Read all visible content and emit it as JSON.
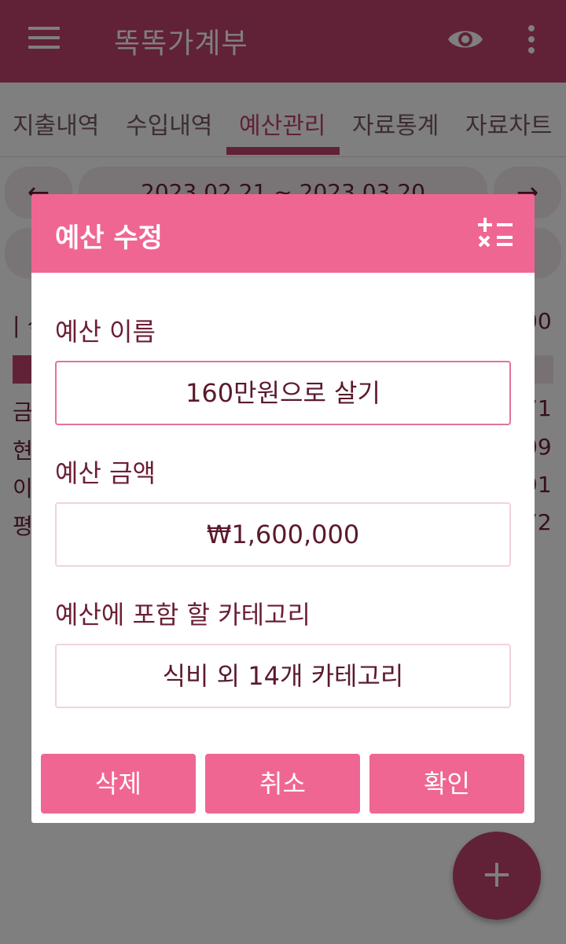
{
  "app": {
    "title": "똑똑가계부"
  },
  "tabs": [
    "지출내역",
    "수입내역",
    "예산관리",
    "자료통계",
    "자료차트"
  ],
  "date_range": {
    "prev": "←",
    "range": "2023.02.21 ~ 2023.03.20",
    "next": "→"
  },
  "background_rows": {
    "first_char": [
      "| 식",
      "금",
      "현",
      "이",
      "평"
    ],
    "last_digits": [
      "00",
      "71",
      "09",
      "91",
      "72"
    ]
  },
  "fab_label": "+",
  "dialog": {
    "title": "예산 수정",
    "budget_name": {
      "label": "예산 이름",
      "value": "160만원으로 살기"
    },
    "budget_amount": {
      "label": "예산 금액",
      "value": "₩1,600,000"
    },
    "categories": {
      "label": "예산에 포함 할 카테고리",
      "value": "식비 외 14개 카테고리"
    },
    "buttons": {
      "delete": "삭제",
      "cancel": "취소",
      "confirm": "확인"
    }
  },
  "colors": {
    "appbar": "#c2426d",
    "dialog_header": "#f06693",
    "button": "#f06693",
    "text_primary": "#6b1f35"
  },
  "icons": [
    "menu-icon",
    "eye-icon",
    "more-vert-icon",
    "calculator-icon",
    "plus-icon"
  ]
}
